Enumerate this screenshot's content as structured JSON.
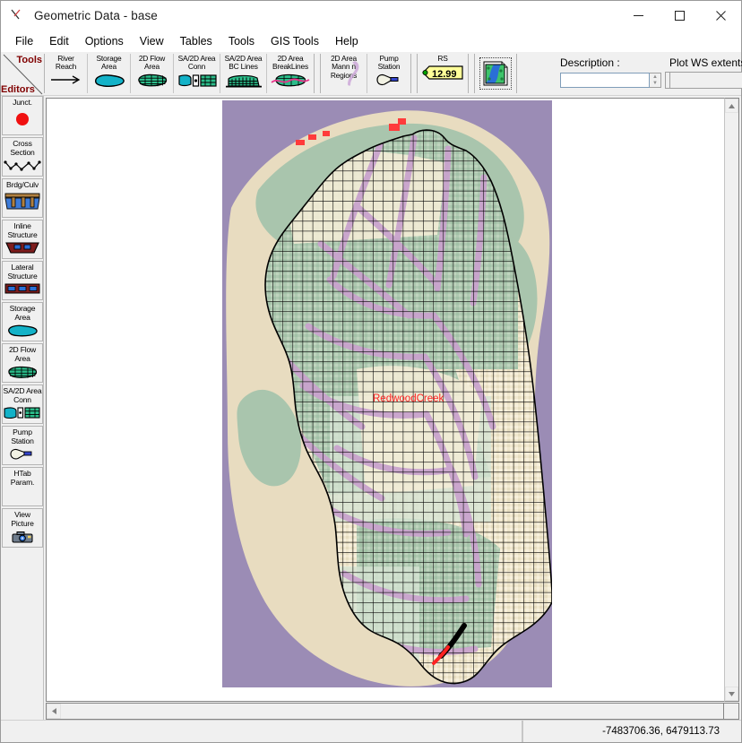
{
  "window": {
    "title": "Geometric Data - base",
    "icon": "river-reach-icon",
    "controls": {
      "minimize": "minimize-icon",
      "maximize": "maximize-icon",
      "close": "close-icon"
    }
  },
  "menu": {
    "items": [
      {
        "label": "File"
      },
      {
        "label": "Edit"
      },
      {
        "label": "Options"
      },
      {
        "label": "View"
      },
      {
        "label": "Tables"
      },
      {
        "label": "Tools"
      },
      {
        "label": "GIS Tools"
      },
      {
        "label": "Help"
      }
    ]
  },
  "palette_label": {
    "tools": "Tools",
    "editors": "Editors"
  },
  "toolbar": {
    "group1": [
      {
        "line1": "River",
        "line2": "Reach",
        "icon": "river-reach-icon"
      },
      {
        "line1": "Storage",
        "line2": "Area",
        "icon": "storage-area-icon"
      },
      {
        "line1": "2D Flow",
        "line2": "Area",
        "icon": "flow-area-icon"
      },
      {
        "line1": "SA/2D Area",
        "line2": "Conn",
        "icon": "sa2d-conn-icon"
      },
      {
        "line1": "SA/2D Area",
        "line2": "BC Lines",
        "icon": "bc-lines-icon"
      },
      {
        "line1": "2D Area",
        "line2": "BreakLines",
        "icon": "breaklines-icon"
      }
    ],
    "group2": [
      {
        "line1": "2D Area",
        "line2": "Mann n",
        "line3": "Regions",
        "icon": "mannings-regions-icon"
      },
      {
        "line1": "Pump",
        "line2": "Station",
        "icon": "pump-station-icon"
      }
    ],
    "group3": [
      {
        "line1": "RS",
        "value": "12.99",
        "icon": "river-station-tag-icon"
      }
    ],
    "group4": [
      {
        "icon": "gis-layers-icon"
      }
    ]
  },
  "description": {
    "label": "Description :",
    "value": "",
    "placeholder": "",
    "ellipsis": "...",
    "spinner_up": "spinner-up-icon",
    "spinner_down": "spinner-down-icon"
  },
  "profile": {
    "label": "Plot WS extents for Profile:",
    "selected": "",
    "options": [],
    "arrow": "chevron-down-icon"
  },
  "sidebar": {
    "items": [
      {
        "line1": "Junct.",
        "line2": "",
        "icon": "junction-icon"
      },
      {
        "line1": "Cross",
        "line2": "Section",
        "icon": "cross-section-icon"
      },
      {
        "line1": "Brdg/Culv",
        "line2": "",
        "icon": "bridge-culvert-icon"
      },
      {
        "line1": "Inline",
        "line2": "Structure",
        "icon": "inline-structure-icon"
      },
      {
        "line1": "Lateral",
        "line2": "Structure",
        "icon": "lateral-structure-icon"
      },
      {
        "line1": "Storage",
        "line2": "Area",
        "icon": "storage-area-icon"
      },
      {
        "line1": "2D Flow",
        "line2": "Area",
        "icon": "flow-area-icon"
      },
      {
        "line1": "SA/2D Area",
        "line2": "Conn",
        "icon": "sa2d-conn-icon"
      },
      {
        "line1": "Pump",
        "line2": "Station",
        "icon": "pump-station-icon"
      },
      {
        "line1": "HTab",
        "line2": "Param.",
        "icon": "htab-param-icon"
      },
      {
        "line1": "View",
        "line2": "Picture",
        "icon": "view-picture-icon"
      }
    ]
  },
  "map": {
    "mesh_label": "RedwoodCreek",
    "mesh_label_color": "#ff2020",
    "background_color": "#9b8cb5",
    "colors": {
      "landcover_purple": "#9b8cb5",
      "landcover_green": "#a9c5ad",
      "landcover_tan": "#ece0c6",
      "landcover_pale_green": "#cfe0cb",
      "landcover_cream": "#f6f0dc",
      "landcover_pink": "#f2d8d8",
      "landcover_lightblue": "#cfe2ee",
      "mesh_line": "#000000",
      "boundary_line": "#000000",
      "bc_line_red": "#ff2b2b",
      "breakline_pink": "#e8a8d8"
    }
  },
  "scrollbars": {
    "v_up": "scroll-up-icon",
    "v_down": "scroll-down-icon",
    "h_left": "scroll-left-icon",
    "h_right": "scroll-right-icon"
  },
  "statusbar": {
    "coordinates": "-7483706.36, 6479113.73"
  }
}
